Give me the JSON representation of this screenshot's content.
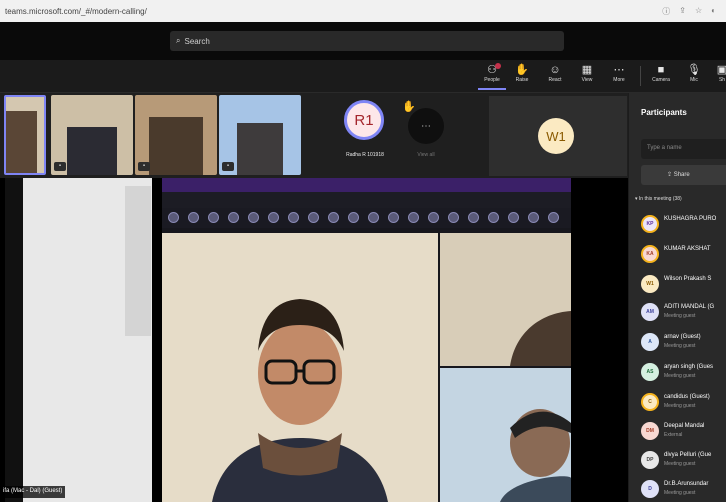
{
  "browser": {
    "url": "teams.microsoft.com/_#/modern-calling/",
    "icons": [
      "info-icon",
      "share-icon",
      "star-icon",
      "profile-icon"
    ]
  },
  "titlebar": {
    "search_placeholder": "Search"
  },
  "toolbar": {
    "buttons": [
      {
        "label": "People",
        "icon": "people-icon",
        "badge": true
      },
      {
        "label": "Raise",
        "icon": "hand-icon"
      },
      {
        "label": "React",
        "icon": "smile-icon"
      },
      {
        "label": "View",
        "icon": "view-icon"
      },
      {
        "label": "More",
        "icon": "more-icon"
      },
      {
        "label": "Camera",
        "icon": "camera-icon"
      },
      {
        "label": "Mic",
        "icon": "mic-icon"
      },
      {
        "label": "Sh",
        "icon": "share-icon"
      }
    ]
  },
  "strip": {
    "r1_initials": "R1",
    "r1_name": "Radha R 101918",
    "view_all": "View all",
    "w1_initials": "W1"
  },
  "stage": {
    "guest_label": "ifa (Mac - Dal) (Guest)"
  },
  "panel": {
    "title": "Participants",
    "search_placeholder": "Type a name",
    "share_label": "Share",
    "section_label": "In this meeting (38)",
    "participants": [
      {
        "initials": "KP",
        "name": "KUSHAGRA PURO",
        "sub": "",
        "color": "#ece5f8",
        "fg": "#5b2c9b",
        "ring": true
      },
      {
        "initials": "KA",
        "name": "KUMAR AKSHAT",
        "sub": "",
        "color": "#f8d8d2",
        "fg": "#a13b25",
        "ring": true
      },
      {
        "initials": "W1",
        "name": "Wilson Prakash S",
        "sub": "",
        "color": "#fbeac2",
        "fg": "#8a5a00",
        "ring": false
      },
      {
        "initials": "AM",
        "name": "ADITI MANDAL (G",
        "sub": "Meeting guest",
        "color": "#dfe1f7",
        "fg": "#3c3f9a",
        "ring": false
      },
      {
        "initials": "A",
        "name": "arnav (Guest)",
        "sub": "Meeting guest",
        "color": "#dde7f8",
        "fg": "#2a5298",
        "ring": false
      },
      {
        "initials": "AS",
        "name": "aryan singh (Gues",
        "sub": "Meeting guest",
        "color": "#d5f0e0",
        "fg": "#1f6b3a",
        "ring": false
      },
      {
        "initials": "C",
        "name": "candidus (Guest)",
        "sub": "Meeting guest",
        "color": "#fbeac2",
        "fg": "#8a5a00",
        "ring": true
      },
      {
        "initials": "DM",
        "name": "Deepal Mandal",
        "sub": "External",
        "color": "#f8d8d2",
        "fg": "#a13b25",
        "ring": false
      },
      {
        "initials": "DP",
        "name": "divya Pelluri (Gue",
        "sub": "Meeting guest",
        "color": "#e8e8e8",
        "fg": "#444",
        "ring": false
      },
      {
        "initials": "D",
        "name": "Dr.B.Arunsundar",
        "sub": "Meeting guest",
        "color": "#dfe1f7",
        "fg": "#3c3f9a",
        "ring": false
      }
    ]
  }
}
